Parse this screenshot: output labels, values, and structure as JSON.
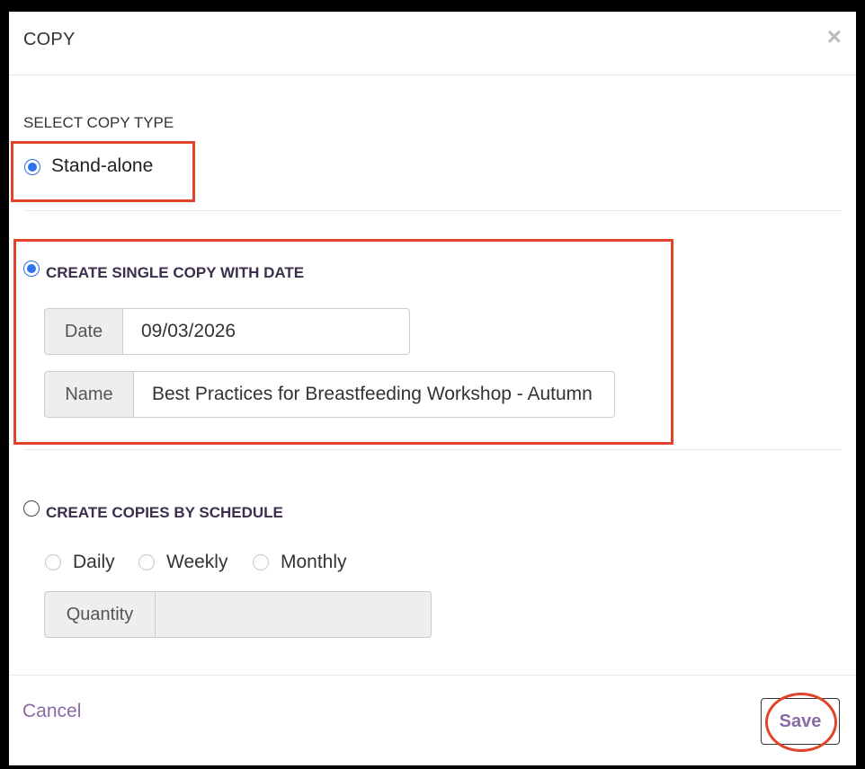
{
  "dialog": {
    "title": "COPY",
    "close_icon": "×"
  },
  "copy_type": {
    "label": "SELECT COPY TYPE",
    "option": "Stand-alone",
    "selected": true
  },
  "single_copy": {
    "heading": "CREATE SINGLE COPY WITH DATE",
    "selected": true,
    "date_label": "Date",
    "date_value": "09/03/2026",
    "name_label": "Name",
    "name_value": "Best Practices for Breastfeeding Workshop - Autumn"
  },
  "schedule": {
    "heading": "CREATE COPIES BY SCHEDULE",
    "selected": false,
    "frequencies": [
      "Daily",
      "Weekly",
      "Monthly"
    ],
    "quantity_label": "Quantity",
    "quantity_value": ""
  },
  "footer": {
    "cancel_label": "Cancel",
    "save_label": "Save"
  },
  "colors": {
    "highlight": "#e1432b",
    "link": "#8a6aa6",
    "radio_selected": "#2f74ea"
  }
}
